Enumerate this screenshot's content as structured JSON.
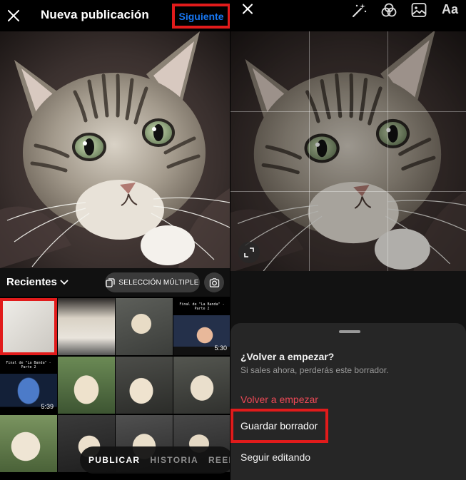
{
  "left_panel": {
    "header": {
      "title": "Nueva publicación",
      "next_label": "Siguiente"
    },
    "gallery": {
      "album_label": "Recientes",
      "multi_select_label": "SELECCIÓN MÚLTIPLE",
      "thumbnails": [
        {
          "kind": "cat-faded",
          "duration": "",
          "selected": true,
          "caption": ""
        },
        {
          "kind": "dog-screen",
          "duration": "",
          "selected": false,
          "caption": ""
        },
        {
          "kind": "dog-couch",
          "duration": "",
          "selected": false,
          "caption": ""
        },
        {
          "kind": "video-stage",
          "duration": "5:30",
          "selected": false,
          "caption": "Final de \"La Banda\" - Parte 2"
        },
        {
          "kind": "video-stage-2",
          "duration": "5:39",
          "selected": false,
          "caption": "Final de \"La Banda\" - Parte 2"
        },
        {
          "kind": "dog-grass",
          "duration": "",
          "selected": false,
          "caption": ""
        },
        {
          "kind": "dog-sofa",
          "duration": "",
          "selected": false,
          "caption": ""
        },
        {
          "kind": "dog-sofa-2",
          "duration": "",
          "selected": false,
          "caption": ""
        },
        {
          "kind": "dog-grass-2",
          "duration": "",
          "selected": false,
          "caption": ""
        },
        {
          "kind": "dog-floor",
          "duration": "",
          "selected": false,
          "caption": ""
        },
        {
          "kind": "dog-floor-2",
          "duration": "",
          "selected": false,
          "caption": ""
        },
        {
          "kind": "dog-floor-3",
          "duration": "",
          "selected": false,
          "caption": ""
        }
      ]
    },
    "mode_tabs": [
      "PUBLICAR",
      "HISTORIA",
      "REEL"
    ],
    "active_mode": "PUBLICAR"
  },
  "right_panel": {
    "toolbar": {
      "icons": [
        "close-icon",
        "magic-wand-icon",
        "filters-icon",
        "image-icon",
        "text-tool-icon"
      ],
      "text_tool_label": "Aa"
    },
    "dialog": {
      "title": "¿Volver a empezar?",
      "subtitle": "Si sales ahora, perderás este borrador.",
      "restart_label": "Volver a empezar",
      "save_draft_label": "Guardar borrador",
      "continue_label": "Seguir editando"
    }
  },
  "colors": {
    "accent_blue": "#1877f2",
    "destructive_red": "#ed4956",
    "highlight_red": "#e11b1b",
    "sheet_background": "#262626"
  }
}
